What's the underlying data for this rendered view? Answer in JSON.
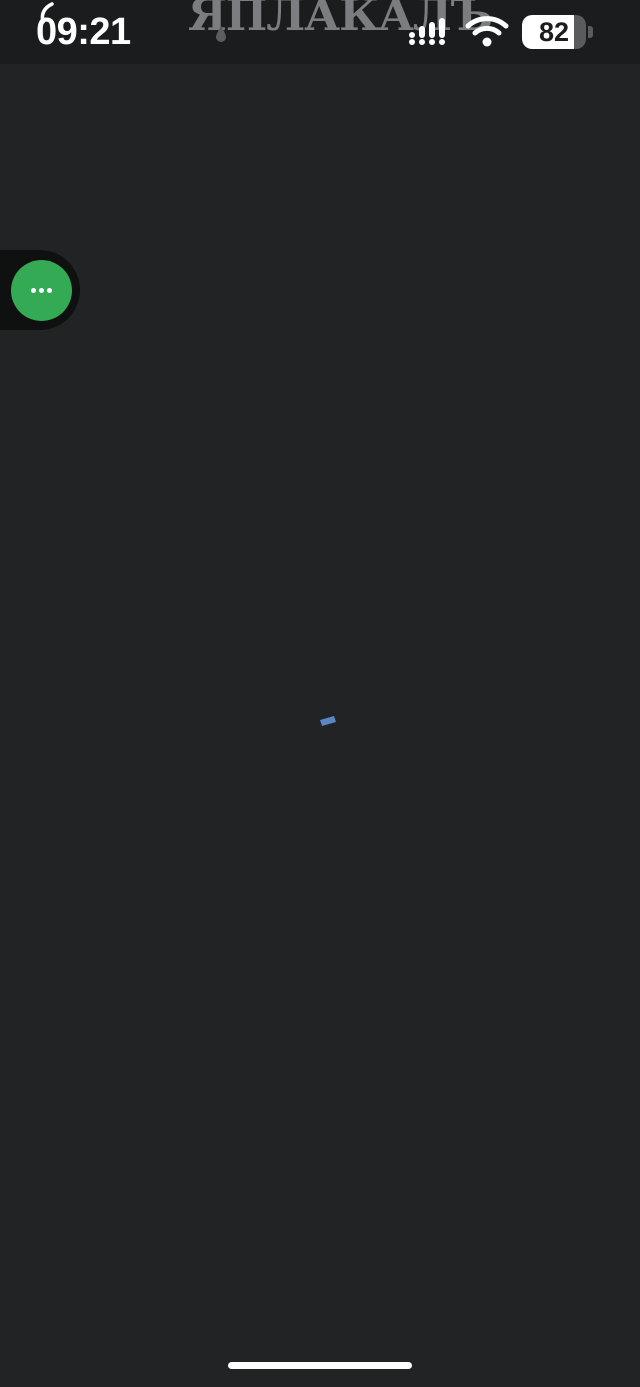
{
  "status_bar": {
    "time": "09:21",
    "battery_level_text": "82",
    "battery_level_fraction": 0.82,
    "icons": [
      "back-hook-icon",
      "signal-icon",
      "wifi-icon",
      "battery-icon"
    ]
  },
  "site": {
    "logo_text": "ЯПЛАКАЛЪ"
  },
  "floating_menu": {
    "icon": "more-dots-icon",
    "color": "#34aa55"
  },
  "main": {
    "state": "loading",
    "spinner_color": "#5b86c4",
    "background": "#222325"
  },
  "home_indicator": {
    "icon": "home-indicator"
  }
}
